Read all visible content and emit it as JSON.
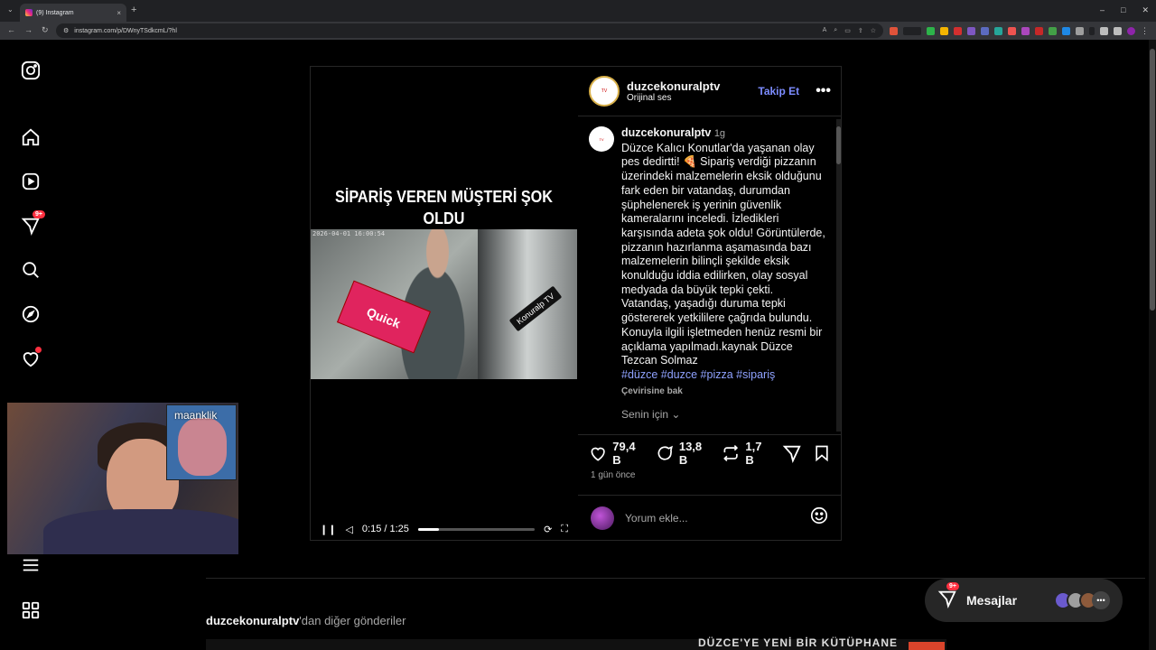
{
  "browser": {
    "tab_title": "(9) Instagram",
    "tab_close": "×",
    "new_tab": "+",
    "url": "instagram.com/p/DWnyTSdkcmL/?hl",
    "win_min": "–",
    "win_max": "□",
    "win_close": "✕"
  },
  "sidebar": {
    "notif_badge": "9+"
  },
  "video": {
    "overlay_line1": "SİPARİŞ VEREN MÜŞTERİ ŞOK",
    "overlay_line2": "OLDU",
    "timestamp": "2026-04-01 16:00:54",
    "box_text": "Quick",
    "watermark": "Konuralp TV",
    "time": "0:15 / 1:25",
    "progress_fraction": 0.18
  },
  "post": {
    "username": "duzcekonuralptv",
    "audio": "Orijinal ses",
    "follow": "Takip Et",
    "more": "•••",
    "caption_user": "duzcekonuralptv",
    "caption_age": "1g",
    "caption_text": "Düzce Kalıcı Konutlar'da yaşanan olay pes dedirtti! 🍕 Sipariş verdiği pizzanın üzerindeki malzemelerin eksik olduğunu fark eden bir vatandaş, durumdan şüphelenerek iş yerinin güvenlik kameralarını inceledi. İzledikleri karşısında adeta şok oldu! Görüntülerde, pizzanın hazırlanma aşamasında bazı malzemelerin bilinçli şekilde eksik konulduğu iddia edilirken, olay sosyal medyada da büyük tepki çekti. Vatandaş, yaşadığı duruma tepki göstererek yetkililere çağrıda bulundu. Konuyla ilgili işletmeden henüz resmi bir açıklama yapılmadı.kaynak Düzce Tezcan Solmaz",
    "hashtags": "#düzce #duzce #pizza #sipariş",
    "translate": "Çevirisine bak",
    "for_you": "Senin için",
    "likes": "79,4 B",
    "comments": "13,8 B",
    "reposts": "1,7 B",
    "time_ago": "1 gün önce",
    "comment_placeholder": "Yorum ekle..."
  },
  "webcam": {
    "label": "maanklik"
  },
  "footer": {
    "more_from_user": "duzcekonuralptv",
    "more_from_suffix": "'dan diğer gönderiler",
    "strip_text": "DÜZCE'YE YENİ BİR KÜTÜPHANE"
  },
  "messages": {
    "label": "Mesajlar",
    "badge": "9+",
    "more": "•••"
  },
  "colors": {
    "accent": "#7c8cff",
    "badge": "#ff3040"
  }
}
